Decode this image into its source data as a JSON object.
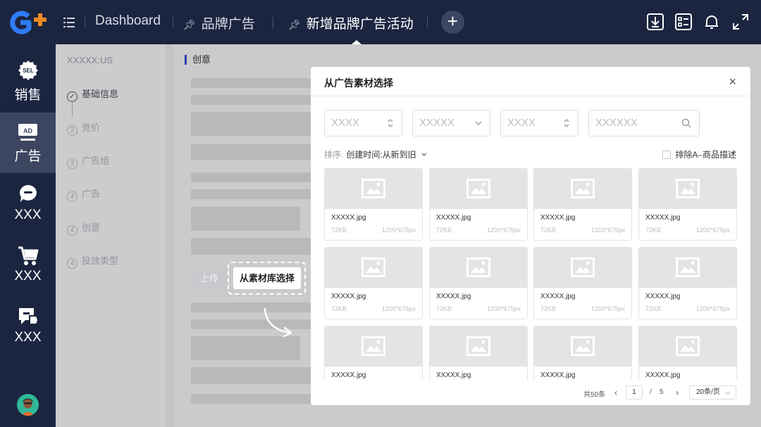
{
  "header": {
    "tabs": [
      {
        "label": "Dashboard"
      },
      {
        "label": "品牌广告"
      },
      {
        "label": "新增品牌广告活动"
      }
    ],
    "add_tab": "+"
  },
  "sidebar": {
    "items": [
      {
        "label": "销售",
        "icon": "sel-badge-icon",
        "badge": "SEL"
      },
      {
        "label": "广告",
        "icon": "ad-badge-icon",
        "badge": "AD"
      },
      {
        "label": "XXX",
        "icon": "chat-icon"
      },
      {
        "label": "XXX",
        "icon": "cart-icon"
      },
      {
        "label": "XXX",
        "icon": "message-tag-icon"
      }
    ]
  },
  "steps": {
    "store": "XXXXX:US",
    "items": [
      {
        "num": "✓",
        "label": "基础信息"
      },
      {
        "num": "2",
        "label": "竞价"
      },
      {
        "num": "3",
        "label": "广告组"
      },
      {
        "num": "4",
        "label": "广告"
      },
      {
        "num": "4",
        "label": "创意"
      },
      {
        "num": "4",
        "label": "投放类型"
      }
    ]
  },
  "main": {
    "section_title": "创意",
    "upload_label": "上传",
    "pick_label": "从素材库选择"
  },
  "modal": {
    "title": "从广告素材选择",
    "close": "×",
    "filters": [
      {
        "placeholder": "XXXX",
        "chev": "◆"
      },
      {
        "placeholder": "XXXXX",
        "chev": "⌄"
      },
      {
        "placeholder": "XXXX",
        "chev": "◆"
      },
      {
        "placeholder": "XXXXXX",
        "chev": "search"
      }
    ],
    "sort_label": "排序:",
    "sort_value": "创建时间:从新到旧",
    "exclude_label": "排除A–商品描述",
    "cards": [
      {
        "name": "XXXXX.jpg",
        "size": "72KB",
        "dim": "1200*675px"
      },
      {
        "name": "XXXXX.jpg",
        "size": "72KB",
        "dim": "1200*675px"
      },
      {
        "name": "XXXXX.jpg",
        "size": "72KB",
        "dim": "1200*675px"
      },
      {
        "name": "XXXXX.jpg",
        "size": "72KB",
        "dim": "1200*675px"
      },
      {
        "name": "XXXXX.jpg",
        "size": "72KB",
        "dim": "1200*675px"
      },
      {
        "name": "XXXXX.jpg",
        "size": "72KB",
        "dim": "1200*675px"
      },
      {
        "name": "XXXXX.jpg",
        "size": "72KB",
        "dim": "1200*675px"
      },
      {
        "name": "XXXXX.jpg",
        "size": "72KB",
        "dim": "1200*675px"
      },
      {
        "name": "XXXXX.jpg",
        "size": "",
        "dim": ""
      },
      {
        "name": "XXXXX.jpg",
        "size": "",
        "dim": ""
      },
      {
        "name": "XXXXX.jpg",
        "size": "",
        "dim": ""
      },
      {
        "name": "XXXXX.jpg",
        "size": "",
        "dim": ""
      }
    ],
    "pagination": {
      "total": "共50条",
      "prev": "‹",
      "current": "1",
      "slash": "/",
      "pages": "5",
      "next": "›",
      "page_size": "20条/页"
    }
  },
  "colors": {
    "nav_bg": "#1b2540",
    "nav_active": "#3c4660",
    "accent": "#2c4fd6",
    "logo_blue": "#2f7cf6",
    "logo_orange": "#f08a24"
  }
}
